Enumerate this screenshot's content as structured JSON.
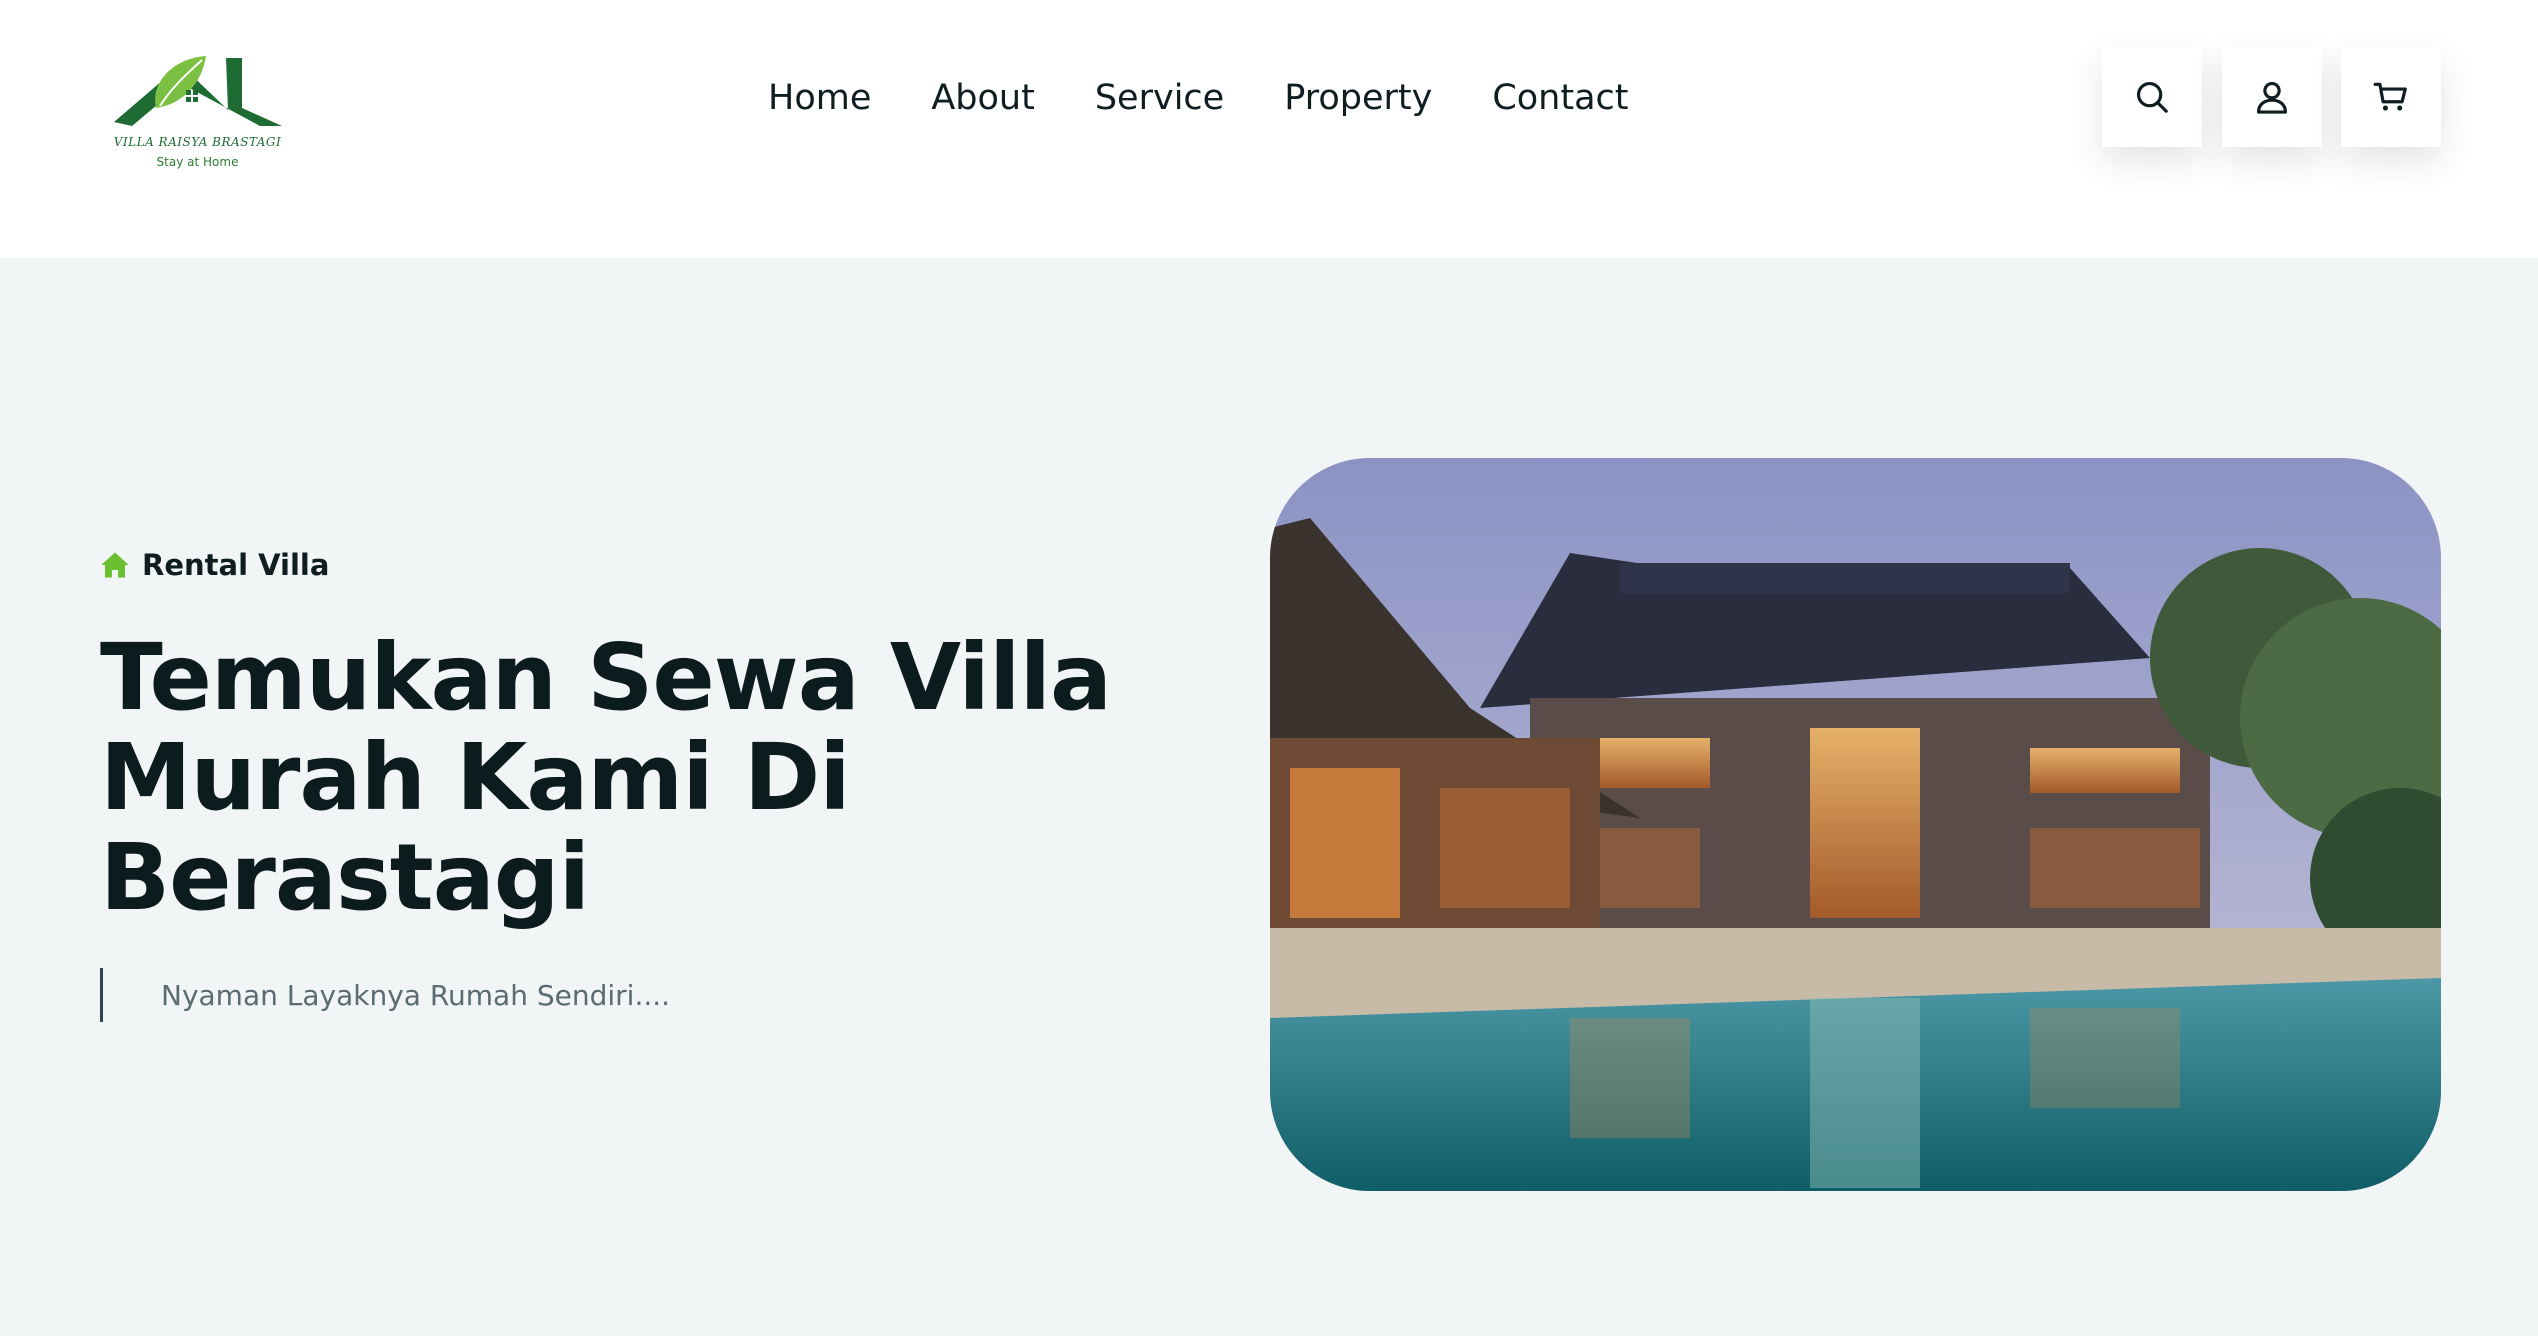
{
  "brand": {
    "name": "VILLA RAISYA BRASTAGI",
    "tagline": "Stay at Home",
    "colors": {
      "primary": "#1e6b34",
      "accent": "#7bc043"
    }
  },
  "nav": {
    "items": [
      {
        "label": "Home"
      },
      {
        "label": "About"
      },
      {
        "label": "Service"
      },
      {
        "label": "Property"
      },
      {
        "label": "Contact"
      }
    ]
  },
  "header_actions": {
    "icons": [
      "search-icon",
      "user-icon",
      "cart-icon"
    ]
  },
  "hero": {
    "badge_label": "Rental Villa",
    "title": "Temukan Sewa Villa Murah Kami Di Berastagi",
    "subtitle": "Nyaman Layaknya Rumah Sendiri....",
    "badge_icon": "home-icon",
    "image": "villa-pool-photo"
  }
}
